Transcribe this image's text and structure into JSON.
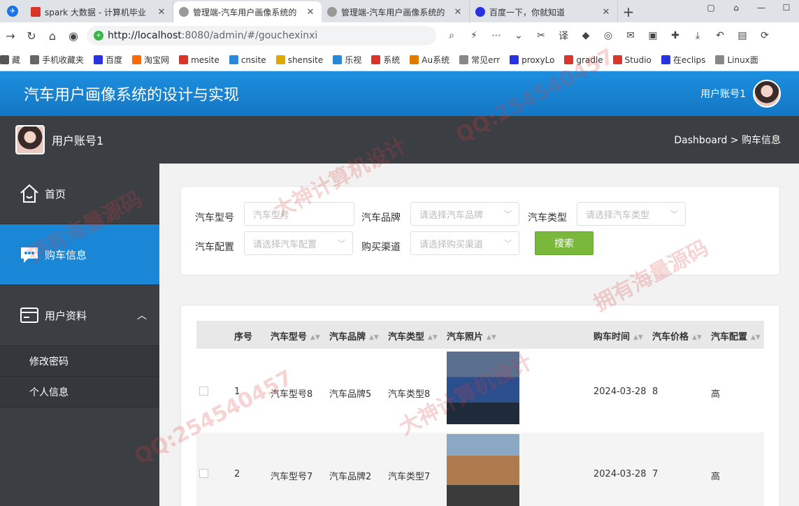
{
  "browser": {
    "tabs": [
      {
        "title": "spark 大数据 - 计算机毕业",
        "active": false,
        "color": "#d9362b"
      },
      {
        "title": "管理端-汽车用户画像系统的",
        "active": true,
        "color": "#888888"
      },
      {
        "title": "管理端-汽车用户画像系统的",
        "active": false,
        "color": "#888888"
      },
      {
        "title": "百度一下，你就知道",
        "active": false,
        "color": "#2932e1"
      }
    ],
    "url_host": "http://localhost",
    "url_path": ":8080/admin/#/gouchexinxi",
    "bookmarks": [
      {
        "label": "藏",
        "color": "#555555"
      },
      {
        "label": "手机收藏夹",
        "color": "#666666"
      },
      {
        "label": "百度",
        "color": "#2932e1"
      },
      {
        "label": "淘宝网",
        "color": "#ff6a00"
      },
      {
        "label": "mesite",
        "color": "#d9362b"
      },
      {
        "label": "cnsite",
        "color": "#2b88d8"
      },
      {
        "label": "shensite",
        "color": "#e0a800"
      },
      {
        "label": "乐视",
        "color": "#2b88d8"
      },
      {
        "label": "系统",
        "color": "#d9362b"
      },
      {
        "label": "Au系统",
        "color": "#e07b00"
      },
      {
        "label": "常见err",
        "color": "#888888"
      },
      {
        "label": "proxyLo",
        "color": "#2932e1"
      },
      {
        "label": "gradle",
        "color": "#d9362b"
      },
      {
        "label": "Studio",
        "color": "#d9362b"
      },
      {
        "label": "在eclips",
        "color": "#2932e1"
      },
      {
        "label": "Linux面",
        "color": "#888888"
      }
    ]
  },
  "header": {
    "title": "汽车用户画像系统的设计与实现",
    "user": "用户账号1"
  },
  "subheader": {
    "user": "用户账号1",
    "breadcrumb": "Dashboard > 购车信息"
  },
  "sidebar": {
    "items": [
      {
        "label": "首页",
        "icon": "home-icon",
        "active": false
      },
      {
        "label": "购车信息",
        "icon": "chat-icon",
        "active": true
      },
      {
        "label": "用户资料",
        "icon": "card-icon",
        "active": false
      }
    ],
    "subitems": [
      "修改密码",
      "个人信息"
    ]
  },
  "search": {
    "model_label": "汽车型号",
    "model_placeholder": "汽车型号",
    "brand_label": "汽车品牌",
    "brand_placeholder": "请选择汽车品牌",
    "type_label": "汽车类型",
    "type_placeholder": "请选择汽车类型",
    "config_label": "汽车配置",
    "config_placeholder": "请选择汽车配置",
    "channel_label": "购买渠道",
    "channel_placeholder": "请选择购买渠道",
    "button": "搜索"
  },
  "table": {
    "columns": [
      "序号",
      "汽车型号",
      "汽车品牌",
      "汽车类型",
      "汽车照片",
      "购车时间",
      "汽车价格",
      "汽车配置"
    ],
    "rows": [
      {
        "index": "1",
        "model": "汽车型号8",
        "brand": "汽车品牌5",
        "type": "汽车类型8",
        "date": "2024-03-28",
        "price": "8",
        "config": "高"
      },
      {
        "index": "2",
        "model": "汽车型号7",
        "brand": "汽车品牌2",
        "type": "汽车类型7",
        "date": "2024-03-28",
        "price": "7",
        "config": "高"
      }
    ]
  },
  "watermarks": [
    "大神计算机设计",
    "拥有海量源码",
    "QQ:254540457"
  ]
}
